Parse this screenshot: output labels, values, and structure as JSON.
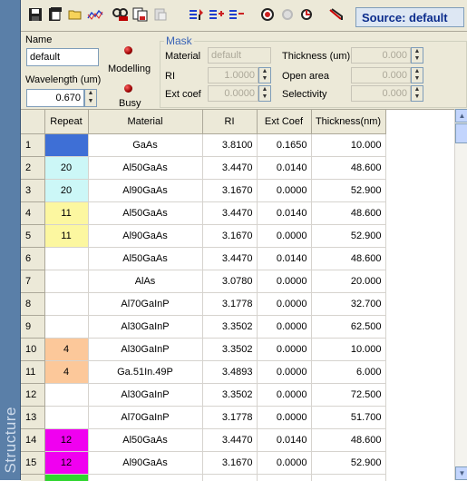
{
  "sidebar": {
    "label": "Structure"
  },
  "toolbar": {
    "source_label": "Source: default"
  },
  "params": {
    "name_label": "Name",
    "name_value": "default",
    "modelling_label": "Modelling",
    "wavelength_label": "Wavelength (um)",
    "wavelength_value": "0.670",
    "busy_label": "Busy"
  },
  "mask": {
    "title": "Mask",
    "material_label": "Material",
    "material_value": "default",
    "ri_label": "RI",
    "ri_value": "1.0000",
    "extcoef_label": "Ext coef",
    "extcoef_value": "0.0000",
    "thickness_label": "Thickness (um)",
    "thickness_value": "0.000",
    "openarea_label": "Open area",
    "openarea_value": "0.000",
    "selectivity_label": "Selectivity",
    "selectivity_value": "0.000"
  },
  "table": {
    "headers": [
      "",
      "Repeat",
      "Material",
      "RI",
      "Ext Coef",
      "Thickness(nm)"
    ],
    "rows": [
      {
        "n": "1",
        "repeat": "",
        "color": "#3e6fd6",
        "material": "GaAs",
        "ri": "3.8100",
        "ext": "0.1650",
        "thick": "10.000"
      },
      {
        "n": "2",
        "repeat": "20",
        "color": "#ccf7f7",
        "material": "Al50GaAs",
        "ri": "3.4470",
        "ext": "0.0140",
        "thick": "48.600"
      },
      {
        "n": "3",
        "repeat": "20",
        "color": "#ccf7f7",
        "material": "Al90GaAs",
        "ri": "3.1670",
        "ext": "0.0000",
        "thick": "52.900"
      },
      {
        "n": "4",
        "repeat": "11",
        "color": "#fcf7a0",
        "material": "Al50GaAs",
        "ri": "3.4470",
        "ext": "0.0140",
        "thick": "48.600"
      },
      {
        "n": "5",
        "repeat": "11",
        "color": "#fcf7a0",
        "material": "Al90GaAs",
        "ri": "3.1670",
        "ext": "0.0000",
        "thick": "52.900"
      },
      {
        "n": "6",
        "repeat": "",
        "color": "",
        "material": "Al50GaAs",
        "ri": "3.4470",
        "ext": "0.0140",
        "thick": "48.600"
      },
      {
        "n": "7",
        "repeat": "",
        "color": "",
        "material": "AlAs",
        "ri": "3.0780",
        "ext": "0.0000",
        "thick": "20.000"
      },
      {
        "n": "8",
        "repeat": "",
        "color": "",
        "material": "Al70GaInP",
        "ri": "3.1778",
        "ext": "0.0000",
        "thick": "32.700"
      },
      {
        "n": "9",
        "repeat": "",
        "color": "",
        "material": "Al30GaInP",
        "ri": "3.3502",
        "ext": "0.0000",
        "thick": "62.500"
      },
      {
        "n": "10",
        "repeat": "4",
        "color": "#fcc89a",
        "material": "Al30GaInP",
        "ri": "3.3502",
        "ext": "0.0000",
        "thick": "10.000"
      },
      {
        "n": "11",
        "repeat": "4",
        "color": "#fcc89a",
        "material": "Ga.51In.49P",
        "ri": "3.4893",
        "ext": "0.0000",
        "thick": "6.000"
      },
      {
        "n": "12",
        "repeat": "",
        "color": "",
        "material": "Al30GaInP",
        "ri": "3.3502",
        "ext": "0.0000",
        "thick": "72.500"
      },
      {
        "n": "13",
        "repeat": "",
        "color": "",
        "material": "Al70GaInP",
        "ri": "3.1778",
        "ext": "0.0000",
        "thick": "51.700"
      },
      {
        "n": "14",
        "repeat": "12",
        "color": "#f000f0",
        "material": "Al50GaAs",
        "ri": "3.4470",
        "ext": "0.0140",
        "thick": "48.600"
      },
      {
        "n": "15",
        "repeat": "12",
        "color": "#f000f0",
        "material": "Al90GaAs",
        "ri": "3.1670",
        "ext": "0.0000",
        "thick": "52.900"
      },
      {
        "n": "",
        "repeat": "",
        "color": "#2fd62f",
        "material": "",
        "ri": "",
        "ext": "",
        "thick": ""
      }
    ]
  }
}
